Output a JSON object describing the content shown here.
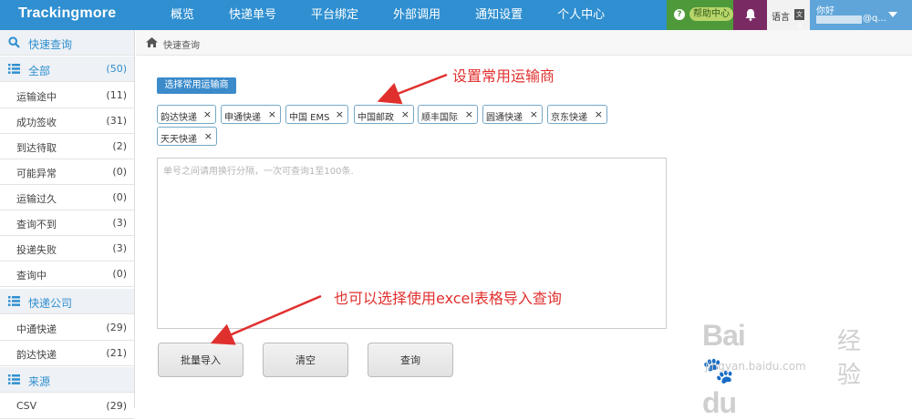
{
  "brand": "Trackingmore",
  "nav": [
    "概览",
    "快递单号",
    "平台绑定",
    "外部调用",
    "通知设置",
    "个人中心"
  ],
  "topbar_right": {
    "help_icon": "?",
    "help_label": "帮助中心",
    "lang_label": "语言",
    "lang_icon": "文A",
    "greeting": "你好",
    "email_suffix": "@q..."
  },
  "sidebar": {
    "search_label": "快速查询",
    "status_header": {
      "label": "全部",
      "count": "(50)"
    },
    "status_items": [
      {
        "label": "运输途中",
        "count": "(11)"
      },
      {
        "label": "成功签收",
        "count": "(31)"
      },
      {
        "label": "到达待取",
        "count": "(2)"
      },
      {
        "label": "可能异常",
        "count": "(0)"
      },
      {
        "label": "运输过久",
        "count": "(0)"
      },
      {
        "label": "查询不到",
        "count": "(3)"
      },
      {
        "label": "投递失败",
        "count": "(3)"
      },
      {
        "label": "查询中",
        "count": "(0)"
      }
    ],
    "company_header": {
      "label": "快递公司"
    },
    "company_items": [
      {
        "label": "中通快递",
        "count": "(29)"
      },
      {
        "label": "韵达快递",
        "count": "(21)"
      }
    ],
    "source_header": {
      "label": "来源"
    },
    "source_items": [
      {
        "label": "CSV",
        "count": "(29)"
      }
    ]
  },
  "breadcrumb": "快速查询",
  "main": {
    "select_carrier_button": "选择常用运输商",
    "carrier_tags": [
      "韵达快递",
      "申通快递",
      "中国 EMS",
      "中国邮政",
      "顺丰国际",
      "圆通快递",
      "京东快递",
      "天天快递"
    ],
    "tag_close": "×",
    "input_placeholder": "单号之间请用换行分隔，一次可查询1至100条.",
    "buttons": {
      "batch_import": "批量导入",
      "clear": "清空",
      "query": "查询"
    }
  },
  "annotations": {
    "top": "设置常用运输商",
    "bottom": "也可以选择使用excel表格导入查询"
  },
  "watermark": {
    "logo": "Bai",
    "logo_suffix": "du",
    "jingyan": "经验",
    "url": "jingyan.baidu.com"
  },
  "colors": {
    "primary": "#2f8fd0",
    "help": "#4e9a3a",
    "bell": "#7a2a63",
    "annotation": "#e0302e"
  }
}
